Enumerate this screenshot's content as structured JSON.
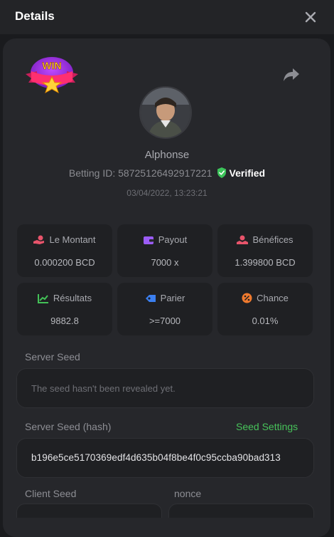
{
  "header": {
    "title": "Details"
  },
  "bet": {
    "username": "Alphonse",
    "betting_label": "Betting ID:",
    "betting_id": "58725126492917221",
    "verified_label": "Verified",
    "timestamp": "03/04/2022, 13:23:21",
    "badge_text": "WIN"
  },
  "stats": [
    {
      "label": "Le Montant",
      "value": "0.000200 BCD",
      "icon": "coins-hand-icon",
      "color": "#e8546b"
    },
    {
      "label": "Payout",
      "value": "7000 x",
      "icon": "wallet-icon",
      "color": "#9b5cf6"
    },
    {
      "label": "Bénéfices",
      "value": "1.399800 BCD",
      "icon": "profit-hand-icon",
      "color": "#e8546b"
    },
    {
      "label": "Résultats",
      "value": "9882.8",
      "icon": "chart-up-icon",
      "color": "#43c157"
    },
    {
      "label": "Parier",
      "value": ">=7000",
      "icon": "ticket-icon",
      "color": "#3b7ff0"
    },
    {
      "label": "Chance",
      "value": "0.01%",
      "icon": "percent-icon",
      "color": "#f07a2e"
    }
  ],
  "server_seed": {
    "label": "Server Seed",
    "placeholder": "The seed hasn't been revealed yet."
  },
  "server_seed_hash": {
    "label": "Server Seed (hash)",
    "settings_link": "Seed Settings",
    "value": "b196e5ce5170369edf4d635b04f8be4f0c95ccba90bad313"
  },
  "client_seed": {
    "label": "Client Seed"
  },
  "nonce": {
    "label": "nonce"
  },
  "colors": {
    "accent_green": "#47c25a",
    "panel": "#26272b",
    "card": "#1f2023"
  }
}
